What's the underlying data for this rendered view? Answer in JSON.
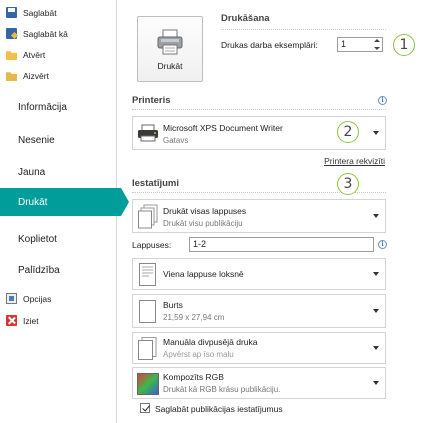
{
  "nav": {
    "save": "Saglabāt",
    "save_as": "Saglabāt kā",
    "open": "Atvērt",
    "close": "Aizvērt",
    "info": "Informācija",
    "recent": "Nesenie",
    "new": "Jauna",
    "print": "Drukāt",
    "share": "Koplietot",
    "help": "Palīdzība",
    "options": "Opcijas",
    "exit": "Iziet"
  },
  "print": {
    "section_title": "Drukāšana",
    "button_label": "Drukāt",
    "copies_label": "Drukas darba eksemplāri:",
    "copies_value": "1"
  },
  "printer": {
    "section_title": "Printeris",
    "name": "Microsoft XPS Document Writer",
    "status": "Gatavs",
    "properties_link": "Printera rekvizīti"
  },
  "settings": {
    "section_title": "Iestatījumi",
    "range_title": "Drukāt visas lappuses",
    "range_sub": "Drukāt visu publikāciju",
    "pages_label": "Lappuses:",
    "pages_value": "1-2",
    "layout_title": "Viena lappuse loksnē",
    "paper_title": "Burts",
    "paper_sub": "21,59 x 27,94 cm",
    "duplex_title": "Manuāla divpusējā druka",
    "duplex_sub": "Apvērst ap īso malu",
    "color_title": "Kompozīts RGB",
    "color_sub": "Drukāt kā RGB krāsu publikāciju.",
    "save_settings_label": "Saglabāt publikācijas iestatījumus",
    "save_settings_checked": true
  },
  "callouts": [
    "1",
    "2",
    "3"
  ],
  "colors": {
    "accent": "#009d9b",
    "callout_border": "#8cc63f"
  }
}
